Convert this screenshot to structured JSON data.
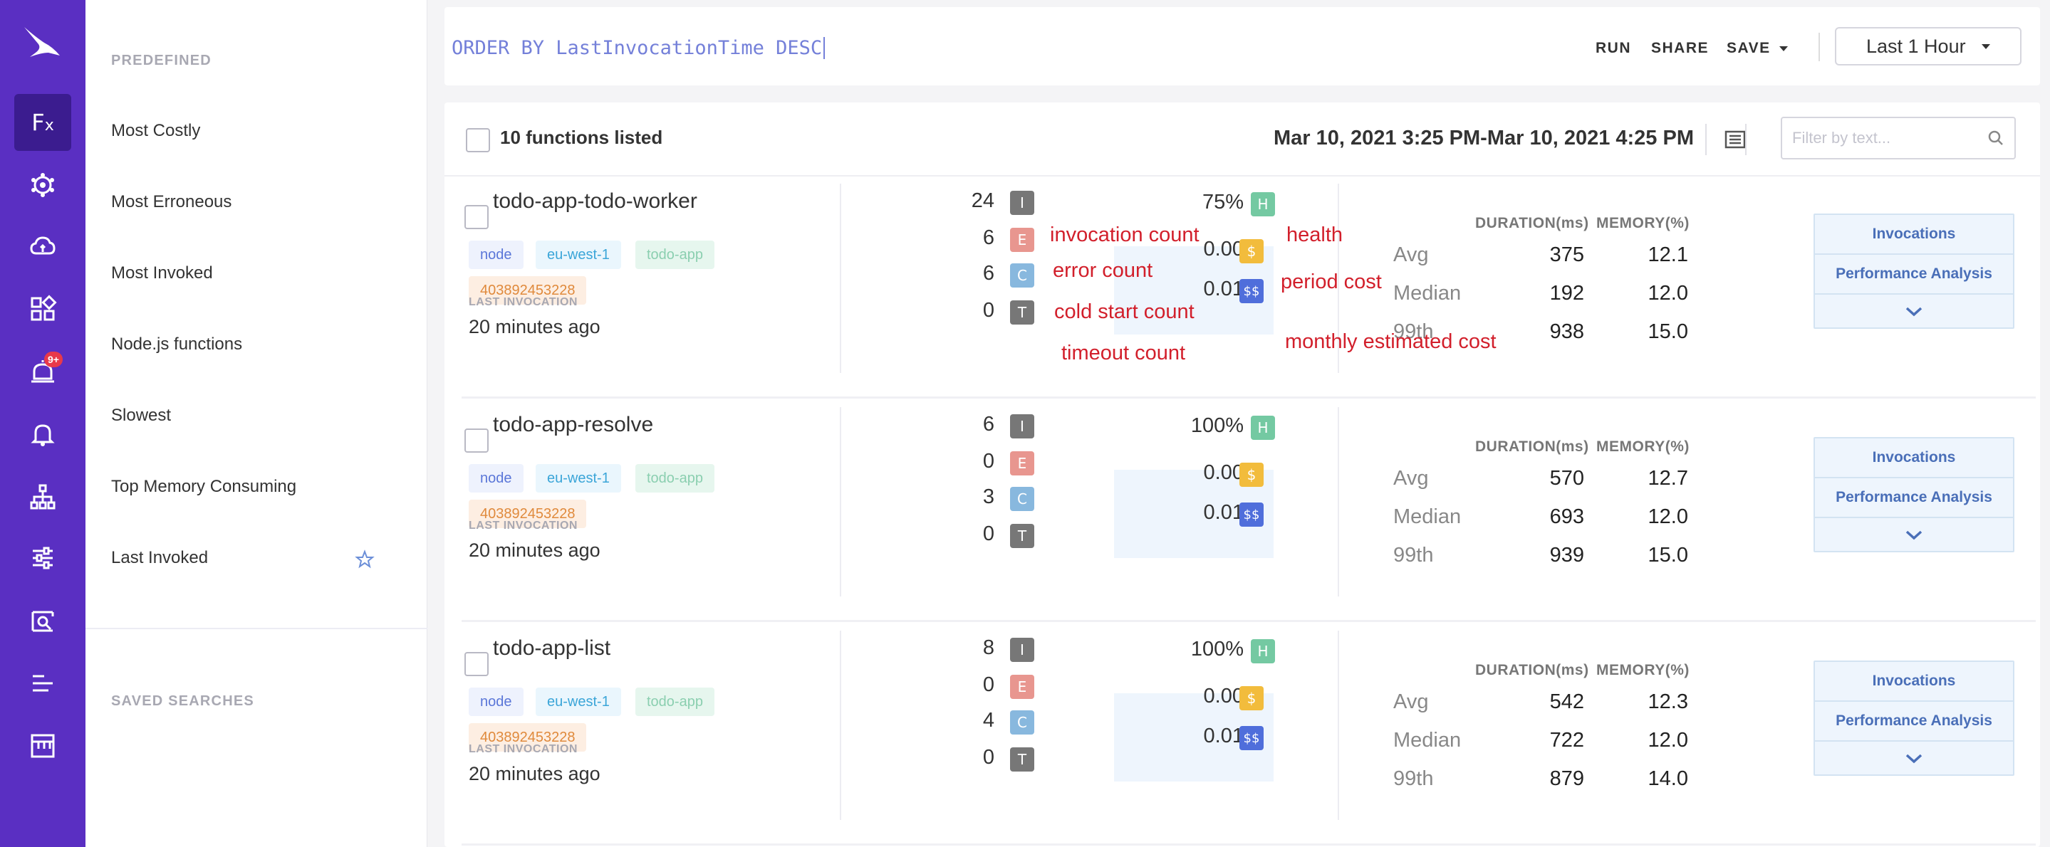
{
  "sidebar_icons": [
    "app-logo-icon",
    "functions-icon",
    "network-icon",
    "cloud-icon",
    "apps-icon",
    "alerts-icon",
    "bell-icon",
    "sitemap-icon",
    "settings-sliders-icon",
    "search-list-icon",
    "list-icon",
    "dashboard-icon"
  ],
  "sidebar_badge": "9+",
  "queries": {
    "predefined_heading": "PREDEFINED",
    "items": [
      "Most Costly",
      "Most Erroneous",
      "Most Invoked",
      "Node.js functions",
      "Slowest",
      "Top Memory Consuming",
      "Last Invoked"
    ],
    "saved_heading": "SAVED SEARCHES"
  },
  "querybar": {
    "query": "ORDER BY LastInvocationTime DESC",
    "run": "RUN",
    "share": "SHARE",
    "save": "SAVE",
    "time_range": "Last 1 Hour"
  },
  "list": {
    "count_label": "10 functions listed",
    "date_range": "Mar 10, 2021 3:25 PM-Mar 10, 2021 4:25 PM",
    "filter_placeholder": "Filter by text..."
  },
  "labels": {
    "last_invocation": "LAST INVOCATION",
    "duration_header": "DURATION(ms)",
    "memory_header": "MEMORY(%)",
    "avg": "Avg",
    "median": "Median",
    "p99": "99th",
    "invocations_btn": "Invocations",
    "performance_btn": "Performance Analysis",
    "badge_i": "I",
    "badge_e": "E",
    "badge_c": "C",
    "badge_t": "T",
    "badge_h": "H",
    "badge_d": "$",
    "badge_dd": "$$"
  },
  "functions": [
    {
      "name": "todo-app-todo-worker",
      "tags": [
        "node",
        "eu-west-1",
        "todo-app",
        "403892453228"
      ],
      "last_invocation": "20 minutes ago",
      "invocations": "24",
      "errors": "6",
      "cold_starts": "6",
      "timeouts": "0",
      "health": "75%",
      "period_cost": "0.00",
      "monthly_cost": "0.01",
      "duration": {
        "avg": "375",
        "median": "192",
        "p99": "938"
      },
      "memory": {
        "avg": "12.1",
        "median": "12.0",
        "p99": "15.0"
      }
    },
    {
      "name": "todo-app-resolve",
      "tags": [
        "node",
        "eu-west-1",
        "todo-app",
        "403892453228"
      ],
      "last_invocation": "20 minutes ago",
      "invocations": "6",
      "errors": "0",
      "cold_starts": "3",
      "timeouts": "0",
      "health": "100%",
      "period_cost": "0.00",
      "monthly_cost": "0.01",
      "duration": {
        "avg": "570",
        "median": "693",
        "p99": "939"
      },
      "memory": {
        "avg": "12.7",
        "median": "12.0",
        "p99": "15.0"
      }
    },
    {
      "name": "todo-app-list",
      "tags": [
        "node",
        "eu-west-1",
        "todo-app",
        "403892453228"
      ],
      "last_invocation": "20 minutes ago",
      "invocations": "8",
      "errors": "0",
      "cold_starts": "4",
      "timeouts": "0",
      "health": "100%",
      "period_cost": "0.00",
      "monthly_cost": "0.01",
      "duration": {
        "avg": "542",
        "median": "722",
        "p99": "879"
      },
      "memory": {
        "avg": "12.3",
        "median": "12.0",
        "p99": "14.0"
      }
    }
  ],
  "annotations": {
    "invocation_count": "invocation count",
    "error_count": "error count",
    "cold_start_count": "cold start count",
    "timeout_count": "timeout count",
    "health": "health",
    "period_cost": "period cost",
    "monthly_cost": "monthly estimated cost"
  },
  "colors": {
    "sidebar": "#5a2fc2",
    "sidebar_active": "#3b1c8f",
    "query_text": "#7480d9",
    "annotation": "#d21f2b"
  }
}
